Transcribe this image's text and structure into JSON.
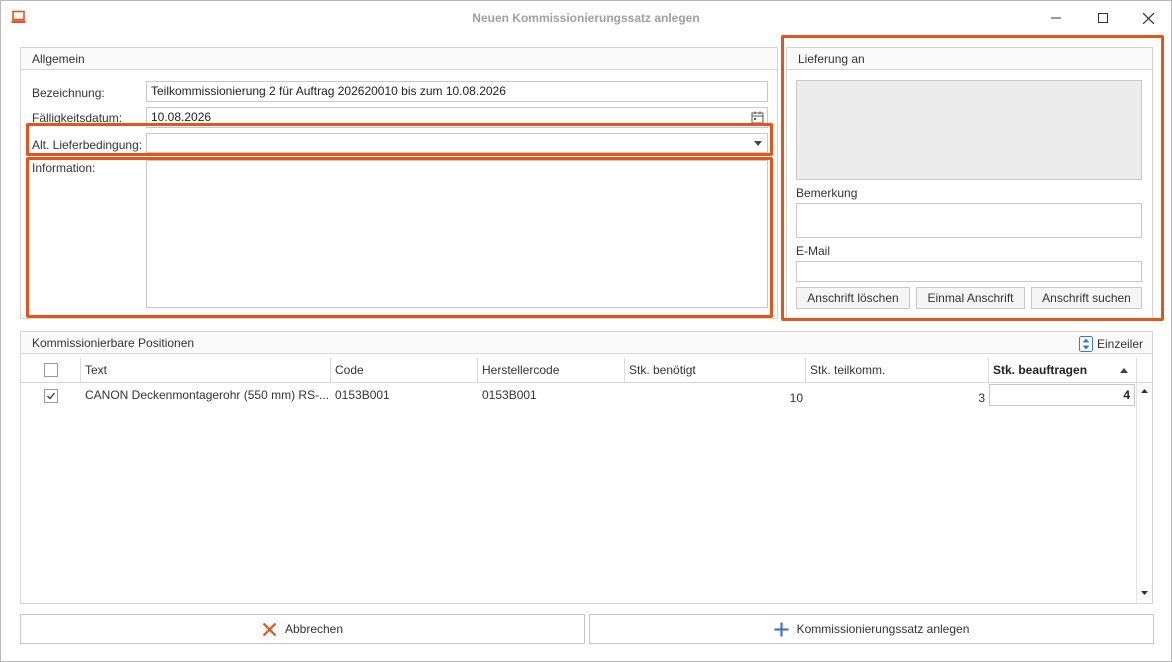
{
  "window": {
    "title": "Neuen Kommissionierungssatz anlegen"
  },
  "allgemein": {
    "header": "Allgemein",
    "bezeichnung_label": "Bezeichnung:",
    "bezeichnung_value": "Teilkommissionierung 2 für Auftrag 202620010 bis zum 10.08.2026",
    "faelligkeit_label": "Fälligkeitsdatum:",
    "faelligkeit_value": "10.08.2026",
    "lieferbedingung_label": "Alt. Lieferbedingung:",
    "lieferbedingung_value": "",
    "information_label": "Information:",
    "information_value": ""
  },
  "lieferung": {
    "header": "Lieferung an",
    "bemerkung_label": "Bemerkung",
    "email_label": "E-Mail",
    "btn_loeschen": "Anschrift löschen",
    "btn_einmal": "Einmal Anschrift",
    "btn_suchen": "Anschrift suchen"
  },
  "positionen": {
    "header": "Kommissionierbare Positionen",
    "einzeiler_label": "Einzeiler",
    "columns": [
      "Text",
      "Code",
      "Herstellercode",
      "Stk. benötigt",
      "Stk. teilkomm.",
      "Stk. beauftragen"
    ],
    "rows": [
      {
        "checked": true,
        "text": "CANON Deckenmontagerohr (550 mm) RS-...",
        "code": "0153B001",
        "herstellercode": "0153B001",
        "benoetigt": "10",
        "teilkomm": "3",
        "beauftragen": "4"
      }
    ]
  },
  "footer": {
    "cancel_label": "Abbrechen",
    "create_label": "Kommissionierungssatz anlegen"
  },
  "colors": {
    "highlight": "#e2561e",
    "cancel_icon": "#e2561e",
    "add_icon": "#3c78c8"
  }
}
